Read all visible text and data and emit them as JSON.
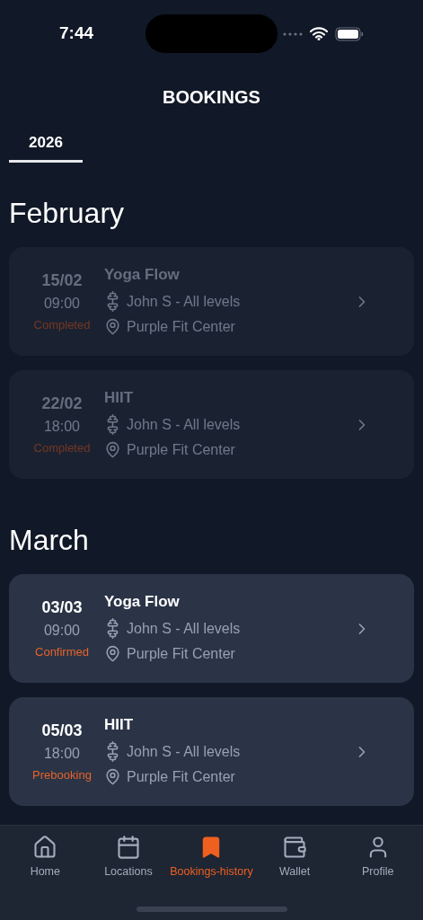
{
  "status_bar": {
    "time": "7:44"
  },
  "title": "BOOKINGS",
  "tabs": [
    {
      "label": "2026",
      "selected": true
    }
  ],
  "months": [
    {
      "name": "February",
      "bookings": [
        {
          "date": "15/02",
          "time": "09:00",
          "status": "Completed",
          "past": true,
          "class": "Yoga Flow",
          "trainer": "John S - All levels",
          "location": "Purple Fit Center"
        },
        {
          "date": "22/02",
          "time": "18:00",
          "status": "Completed",
          "past": true,
          "class": "HIIT",
          "trainer": "John S - All levels",
          "location": "Purple Fit Center"
        }
      ]
    },
    {
      "name": "March",
      "bookings": [
        {
          "date": "03/03",
          "time": "09:00",
          "status": "Confirmed",
          "past": false,
          "class": "Yoga Flow",
          "trainer": "John S - All levels",
          "location": "Purple Fit Center"
        },
        {
          "date": "05/03",
          "time": "18:00",
          "status": "Prebooking",
          "past": false,
          "class": "HIIT",
          "trainer": "John S - All levels",
          "location": "Purple Fit Center"
        }
      ]
    }
  ],
  "nav": [
    {
      "kind": "home",
      "label": "Home",
      "selected": false
    },
    {
      "kind": "calendar",
      "label": "Locations",
      "selected": false
    },
    {
      "kind": "bookmark",
      "label": "Bookings-history",
      "selected": true
    },
    {
      "kind": "wallet",
      "label": "Wallet",
      "selected": false
    },
    {
      "kind": "profile",
      "label": "Profile",
      "selected": false
    }
  ]
}
